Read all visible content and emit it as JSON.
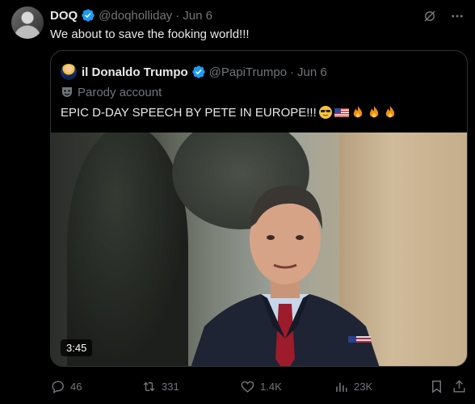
{
  "tweet": {
    "author": {
      "name": "DOQ",
      "handle": "@doqholliday",
      "verified": true
    },
    "separator": "·",
    "date": "Jun 6",
    "text": "We about to save the fooking world!!!",
    "icons": {
      "grok": "grok-icon",
      "more": "more-icon"
    }
  },
  "quote": {
    "author": {
      "name": "il Donaldo Trumpo",
      "handle": "@PapiTrumpo",
      "verified": true
    },
    "separator": "·",
    "date": "Jun 6",
    "parody_label": "Parody account",
    "text": "EPIC D-DAY SPEECH BY PETE IN EUROPE!!!",
    "emojis": [
      "sunglasses-emoji",
      "us-flag-emoji",
      "fire-emoji",
      "fire-emoji",
      "fire-emoji"
    ],
    "media": {
      "type": "video",
      "duration": "3:45"
    }
  },
  "actions": {
    "replies": "46",
    "reposts": "331",
    "likes": "1.4K",
    "views": "23K"
  },
  "colors": {
    "background": "#000000",
    "text": "#e7e9ea",
    "muted": "#71767b",
    "verified": "#1d9bf0",
    "border": "#2f3336"
  }
}
